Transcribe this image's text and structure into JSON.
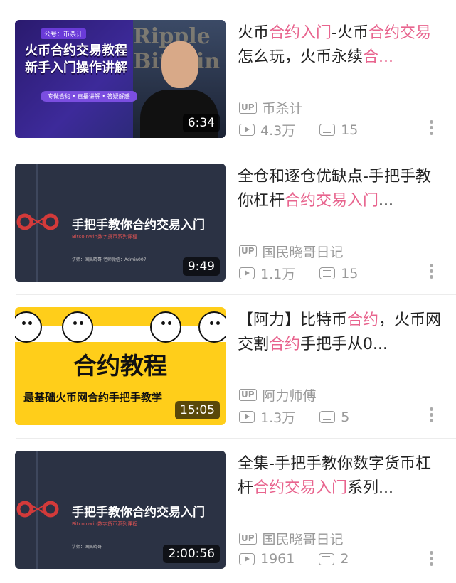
{
  "videos": [
    {
      "title_parts": [
        "火币",
        "合约入门",
        "-火币",
        "合约交易",
        "怎么玩，火币永续",
        "合..."
      ],
      "uploader": "币杀计",
      "plays": "4.3万",
      "danmaku": "15",
      "duration": "6:34",
      "thumb": {
        "tag": "公号：币杀计",
        "line1": "火币合约交易教程",
        "line2": "新手入门操作讲解",
        "sub": "专做合约 • 直播讲解 • 答疑解惑",
        "bg": "Ripple Bitcoin"
      }
    },
    {
      "title_parts": [
        "全仓和逐仓优缺点-手把手教你杠杆",
        "合约交易入门",
        "..."
      ],
      "uploader": "国民晓哥日记",
      "plays": "1.1万",
      "danmaku": "15",
      "duration": "9:49",
      "thumb": {
        "title": "手把手教你合约交易入门",
        "sub": "Bitcoinwin数字货币系列课程",
        "foot": "讲师：国民晓哥        老师微信：Admin007"
      }
    },
    {
      "title_parts": [
        "【阿力】比特币",
        "合约",
        "，火币网交割",
        "合约",
        "手把手从0..."
      ],
      "uploader": "阿力师傅",
      "plays": "1.3万",
      "danmaku": "5",
      "duration": "15:05",
      "thumb": {
        "big": "合约教程",
        "bottom": "最基础火币网合约手把手教学"
      }
    },
    {
      "title_parts": [
        "全集-手把手教你数字货币杠杆",
        "合约交易入门",
        "系列..."
      ],
      "uploader": "国民晓哥日记",
      "plays": "1961",
      "danmaku": "2",
      "duration": "2:00:56",
      "thumb": {
        "title": "手把手教你合约交易入门",
        "sub": "Bitcoinwin数字货币系列课程",
        "foot": "讲师：国民晓哥"
      }
    }
  ],
  "labels": {
    "up_badge": "UP"
  },
  "colors": {
    "highlight": "#e8648e",
    "meta": "#999999"
  }
}
